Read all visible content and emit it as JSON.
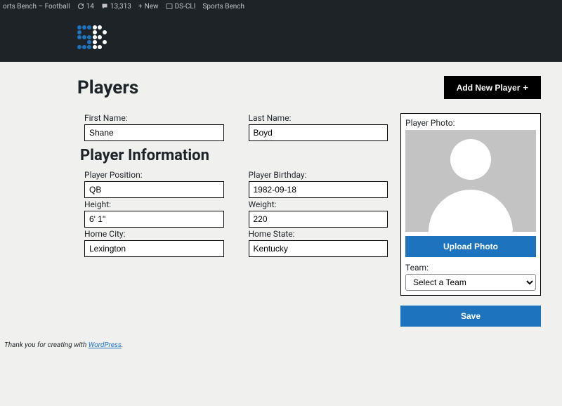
{
  "admin_bar": {
    "site_label": "orts Bench – Football",
    "updates_count": "14",
    "comments_count": "13,313",
    "new_label": "New",
    "dscli_label": "DS-CLI",
    "sports_bench_label": "Sports Bench"
  },
  "page": {
    "title": "Players",
    "add_button": "Add New Player"
  },
  "sections": {
    "info_title": "Player Information"
  },
  "fields": {
    "first_name": {
      "label": "First Name:",
      "value": "Shane"
    },
    "last_name": {
      "label": "Last Name:",
      "value": "Boyd"
    },
    "position": {
      "label": "Player Position:",
      "value": "QB"
    },
    "birthday": {
      "label": "Player Birthday:",
      "value": "1982-09-18"
    },
    "height": {
      "label": "Height:",
      "value": "6' 1\""
    },
    "weight": {
      "label": "Weight:",
      "value": "220"
    },
    "home_city": {
      "label": "Home City:",
      "value": "Lexington"
    },
    "home_state": {
      "label": "Home State:",
      "value": "Kentucky"
    }
  },
  "photo": {
    "label": "Player Photo:",
    "upload_label": "Upload Photo"
  },
  "team": {
    "label": "Team:",
    "selected": "Select a Team"
  },
  "actions": {
    "save": "Save"
  },
  "footer": {
    "credit_text": "Thank you for creating with ",
    "link_text": "WordPress",
    "suffix": "."
  }
}
